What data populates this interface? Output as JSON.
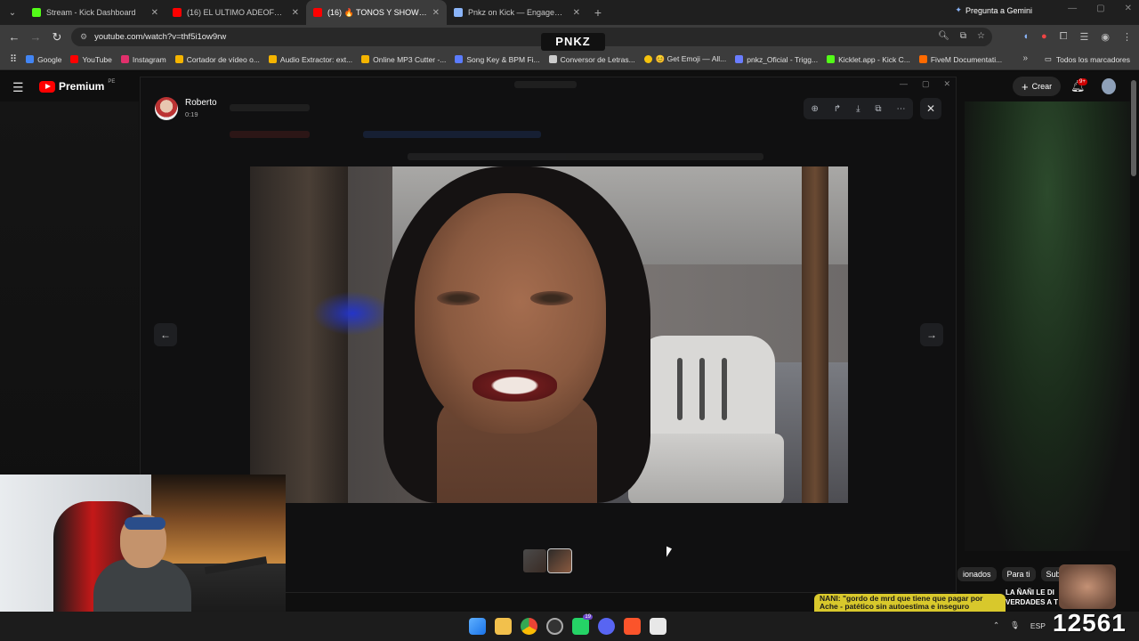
{
  "browser": {
    "tabs": [
      {
        "title": "Stream - Kick Dashboard",
        "color": "#53fc18",
        "active": false
      },
      {
        "title": "(16) EL ULTIMO ADEOFF 👤 - P",
        "color": "#ff0000",
        "active": false
      },
      {
        "title": "(16) 🔥 TONOS Y SHOW 🔥 SID",
        "color": "#ff0000",
        "active": true
      },
      {
        "title": "Pnkz on Kick — Engagement A",
        "color": "#8ab4f8",
        "active": false
      }
    ],
    "gemini_label": "Pregunta a Gemini",
    "url": "youtube.com/watch?v=thf5i1ow9rw",
    "bookmarks": [
      {
        "label": "Google",
        "color": "#4285f4"
      },
      {
        "label": "YouTube",
        "color": "#ff0000"
      },
      {
        "label": "Instagram",
        "color": "#e1306c"
      },
      {
        "label": "Cortador de vídeo o...",
        "color": "#f4b400"
      },
      {
        "label": "Audio Extractor: ext...",
        "color": "#f4b400"
      },
      {
        "label": "Online MP3 Cutter -...",
        "color": "#f4b400"
      },
      {
        "label": "Song Key & BPM Fi...",
        "color": "#5b7cff"
      },
      {
        "label": "Conversor de Letras...",
        "color": "#cccccc"
      },
      {
        "label": "😊 Get Emoji — All...",
        "color": "#f4c20d"
      },
      {
        "label": "pnkz_Oficial - Trigg...",
        "color": "#6a7dff"
      },
      {
        "label": "Kicklet.app - Kick C...",
        "color": "#53fc18"
      },
      {
        "label": "FiveM Documentati...",
        "color": "#ff6a00"
      }
    ],
    "bookmarks_all": "Todos los marcadores",
    "stream_logo": "PNKZ"
  },
  "youtube": {
    "logo_label": "Premium",
    "country": "PE",
    "create_label": "Crear",
    "notif_count": "9+",
    "chips": [
      "ionados",
      "Para ti",
      "Subid"
    ]
  },
  "viewer": {
    "user_name": "Roberto",
    "timestamp": "0:19"
  },
  "overlay": {
    "banner_text": "NANI: \"gordo de mrd que tiene que pagar por Ache - patético sin autoestima e inseguro",
    "side_text": [
      "LA ÑAÑI LE DI",
      "VERDADES A T"
    ],
    "count": "12561"
  },
  "taskbar": {
    "tray_lang": "ESP",
    "discord_badge": "19"
  }
}
